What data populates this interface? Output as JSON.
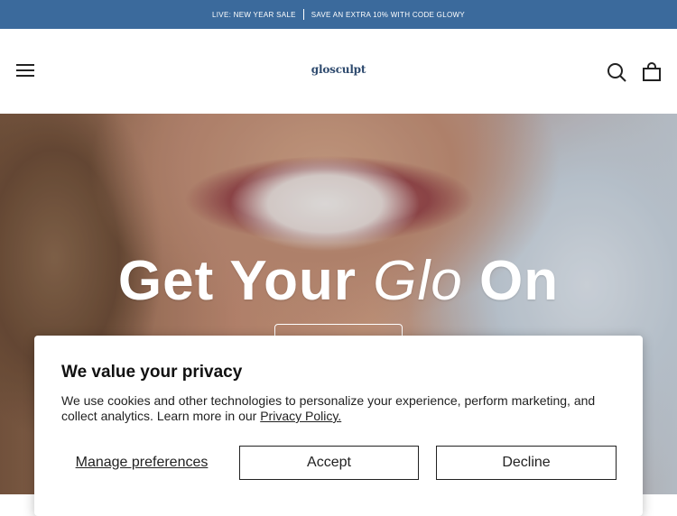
{
  "announcement": {
    "left_text": "LIVE: NEW YEAR SALE",
    "right_text": "SAVE AN EXTRA 10% WITH CODE GLOWY",
    "background": "#3b6a9c"
  },
  "header": {
    "logo_text": "glosculpt",
    "menu_icon": "hamburger-icon",
    "search_icon": "search-icon",
    "cart_icon": "shopping-bag-icon"
  },
  "hero": {
    "title_pre": "Get Your",
    "title_em": "Glo",
    "title_post": "On",
    "cta_label": ""
  },
  "cookie_banner": {
    "title": "We value your privacy",
    "body": "We use cookies and other technologies to personalize your experience, perform marketing, and collect analytics. Learn more in our",
    "link_text": "Privacy Policy.",
    "manage_label": "Manage preferences",
    "accept_label": "Accept",
    "decline_label": "Decline"
  }
}
